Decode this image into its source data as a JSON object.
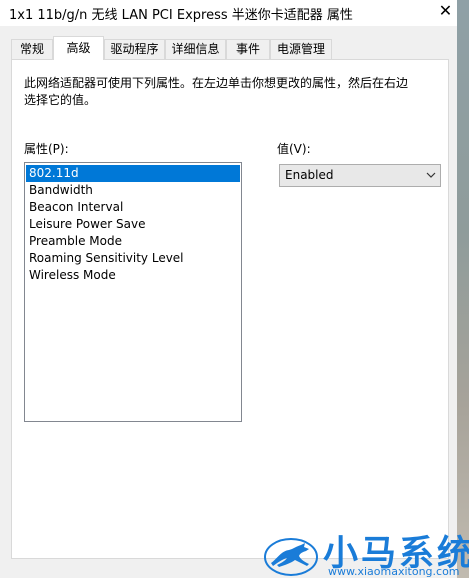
{
  "window": {
    "title": "1x1 11b/g/n 无线 LAN PCI Express 半迷你卡适配器 属性",
    "close_glyph": "✕"
  },
  "tabs": [
    {
      "label": "常规",
      "active": false
    },
    {
      "label": "高级",
      "active": true
    },
    {
      "label": "驱动程序",
      "active": false
    },
    {
      "label": "详细信息",
      "active": false
    },
    {
      "label": "事件",
      "active": false
    },
    {
      "label": "电源管理",
      "active": false
    }
  ],
  "advanced": {
    "description": "此网络适配器可使用下列属性。在左边单击你想更改的属性，然后在右边选择它的值。",
    "property_label": "属性(P):",
    "value_label": "值(V):",
    "properties": [
      "802.11d",
      "Bandwidth",
      "Beacon Interval",
      "Leisure Power Save",
      "Preamble Mode",
      "Roaming Sensitivity Level",
      "Wireless Mode"
    ],
    "selected_index": 0,
    "selected_value": "Enabled"
  },
  "watermark": {
    "brand": "小马系统",
    "url": "www.xiaomaxitong.com",
    "color": "#1a7cd8"
  },
  "colors": {
    "selection": "#0078d7"
  }
}
